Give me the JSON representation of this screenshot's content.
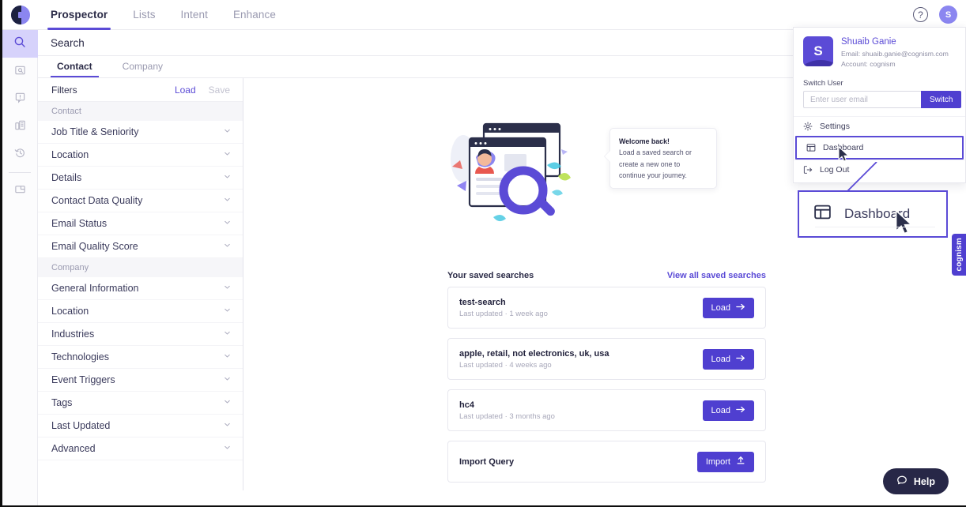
{
  "topbar": {
    "logo": "cognism-logo",
    "tabs": [
      {
        "label": "Prospector",
        "active": true
      },
      {
        "label": "Lists",
        "active": false
      },
      {
        "label": "Intent",
        "active": false
      },
      {
        "label": "Enhance",
        "active": false
      }
    ],
    "help_icon": "question-mark-icon",
    "avatar_initial": "S"
  },
  "rail": {
    "items": [
      {
        "name": "search",
        "icon": "magnifier-icon",
        "active": true
      },
      {
        "name": "saved-searches",
        "icon": "folder-search-icon",
        "active": false
      },
      {
        "name": "alerts",
        "icon": "alert-bubble-icon",
        "active": false
      },
      {
        "name": "companies",
        "icon": "building-icon",
        "active": false
      },
      {
        "name": "history",
        "icon": "history-clock-icon",
        "active": false
      },
      {
        "name": "archive",
        "icon": "archive-box-icon",
        "active": false
      }
    ]
  },
  "search_header": {
    "title": "Search"
  },
  "subtabs": [
    {
      "label": "Contact",
      "active": true
    },
    {
      "label": "Company",
      "active": false
    }
  ],
  "filters": {
    "title": "Filters",
    "load_label": "Load",
    "save_label": "Save",
    "groups": [
      {
        "label": "Contact",
        "rows": [
          "Job Title & Seniority",
          "Location",
          "Details",
          "Contact Data Quality",
          "Email Status",
          "Email Quality Score"
        ]
      },
      {
        "label": "Company",
        "rows": [
          "General Information",
          "Location",
          "Industries",
          "Technologies",
          "Event Triggers",
          "Tags",
          "Last Updated",
          "Advanced"
        ]
      }
    ]
  },
  "hero": {
    "tooltip_title": "Welcome back!",
    "tooltip_body": "Load a saved search or create a new one to continue your journey."
  },
  "saved": {
    "title": "Your saved searches",
    "view_all_label": "View all saved searches",
    "items": [
      {
        "name": "test-search",
        "meta": "Last updated · 1 week ago",
        "button": "Load",
        "button_icon": "arrow-right-icon"
      },
      {
        "name": "apple, retail, not electronics, uk, usa",
        "meta": "Last updated · 4 weeks ago",
        "button": "Load",
        "button_icon": "arrow-right-icon"
      },
      {
        "name": "hc4",
        "meta": "Last updated · 3 months ago",
        "button": "Load",
        "button_icon": "arrow-right-icon"
      },
      {
        "name": "Import Query",
        "meta": "",
        "button": "Import",
        "button_icon": "upload-icon"
      }
    ]
  },
  "dropdown": {
    "avatar_initial": "S",
    "name": "Shuaib Ganie",
    "email_line": "Email: shuaib.ganie@cognism.com",
    "account_line": "Account: cognism",
    "switch_user_label": "Switch User",
    "email_placeholder": "Enter user email",
    "email_value": "",
    "switch_button": "Switch",
    "menu": [
      {
        "label": "Settings",
        "icon": "gear-icon",
        "highlighted": false
      },
      {
        "label": "Dashboard",
        "icon": "dashboard-layout-icon",
        "highlighted": true
      },
      {
        "label": "Log Out",
        "icon": "logout-icon",
        "highlighted": false
      }
    ]
  },
  "callout": {
    "label": "Dashboard",
    "icon": "dashboard-layout-icon"
  },
  "side_tab": {
    "label": "cognism"
  },
  "help": {
    "label": "Help",
    "icon": "chat-bubble-icon"
  },
  "colors": {
    "brand_purple": "#5b4bd6",
    "button_purple": "#4f3fd0",
    "rail_active_bg": "#d6d2fb",
    "dark_navy": "#272747",
    "muted_text": "#9a9ab0"
  }
}
